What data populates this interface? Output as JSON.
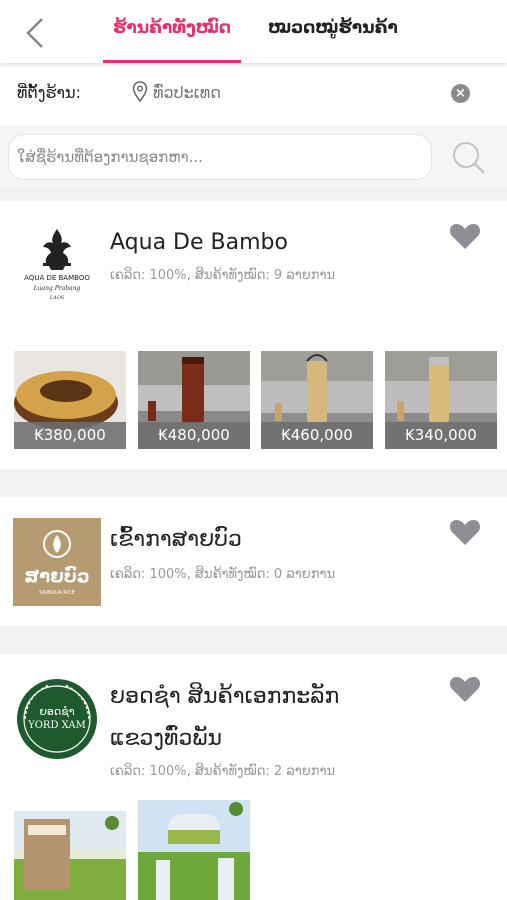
{
  "header": {
    "tabs": [
      {
        "label": "ຮ້ານຄ້າທັງໝົດ",
        "active": true
      },
      {
        "label": "ໝວດໝູ່ຮ້ານຄ້າ",
        "active": false
      }
    ]
  },
  "location": {
    "label": "ທີ່ຕັ້ງຮ້ານ:",
    "value": "ທົ່ວປະເທດ"
  },
  "search": {
    "placeholder": "ໃສ່ຊື່ຮ້ານທີ່ຕ້ອງການຊອກຫາ..."
  },
  "colors": {
    "accent": "#e5306f"
  },
  "shops": [
    {
      "name": "Aqua De Bambo",
      "meta": "ເຄລິດ: 100%, ສິນຄ້າທັງໝົດ: 9 ລາຍການ",
      "logo_text": [
        "AQUA DE BAMBOO",
        "Luang Prabang",
        "LAOS"
      ],
      "products": [
        {
          "price": "₭380,000"
        },
        {
          "price": "₭480,000"
        },
        {
          "price": "₭460,000"
        },
        {
          "price": "₭340,000"
        }
      ]
    },
    {
      "name": "ເຂົ້າກາສາຍບົວ",
      "meta": "ເຄລິດ: 100%, ສິນຄ້າທັງໝົດ: 0 ລາຍການ",
      "logo_text": [
        "ສາຍບົວ",
        "SAIBOUA RICE"
      ],
      "products": []
    },
    {
      "name_lines": [
        "ຍອດຊໍາ ສິນຄ້າເອກກະລັກ",
        "ແຂວງທົ່ວພັນ"
      ],
      "meta": "ເຄລິດ: 100%, ສິນຄ້າທັງໝົດ: 2 ລາຍການ",
      "logo_text": [
        "ຍອດຊໍາ",
        "YORD XAM"
      ],
      "products": [
        {},
        {}
      ]
    }
  ]
}
